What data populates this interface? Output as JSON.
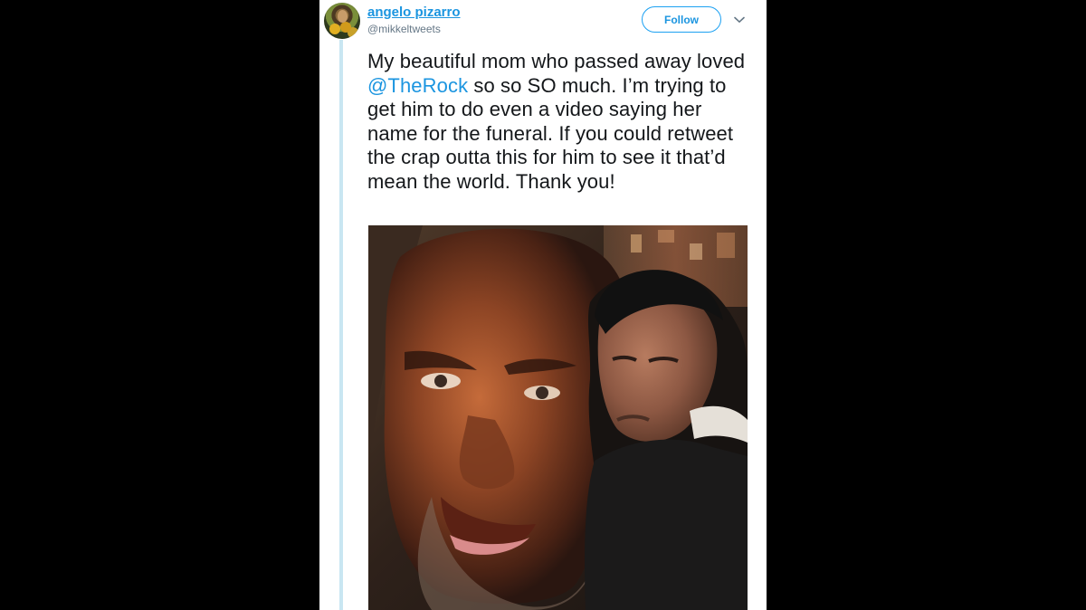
{
  "author": {
    "display_name": "angelo pizarro",
    "handle": "@mikkeltweets"
  },
  "actions": {
    "follow_label": "Follow",
    "more_icon": "chevron-down-icon"
  },
  "tweet": {
    "text_before": "My beautiful mom who passed away loved ",
    "mention": "@TheRock",
    "text_after": " so so SO much. I’m trying to get him to do even a video saying her name for the funeral. If you could retweet the crap outta this for him to see it that’d mean the world. Thank you!"
  },
  "colors": {
    "accent": "#1b95e0",
    "text": "#14171a",
    "muted": "#657786",
    "thread_line": "#c9e6f2",
    "background": "#000000"
  }
}
